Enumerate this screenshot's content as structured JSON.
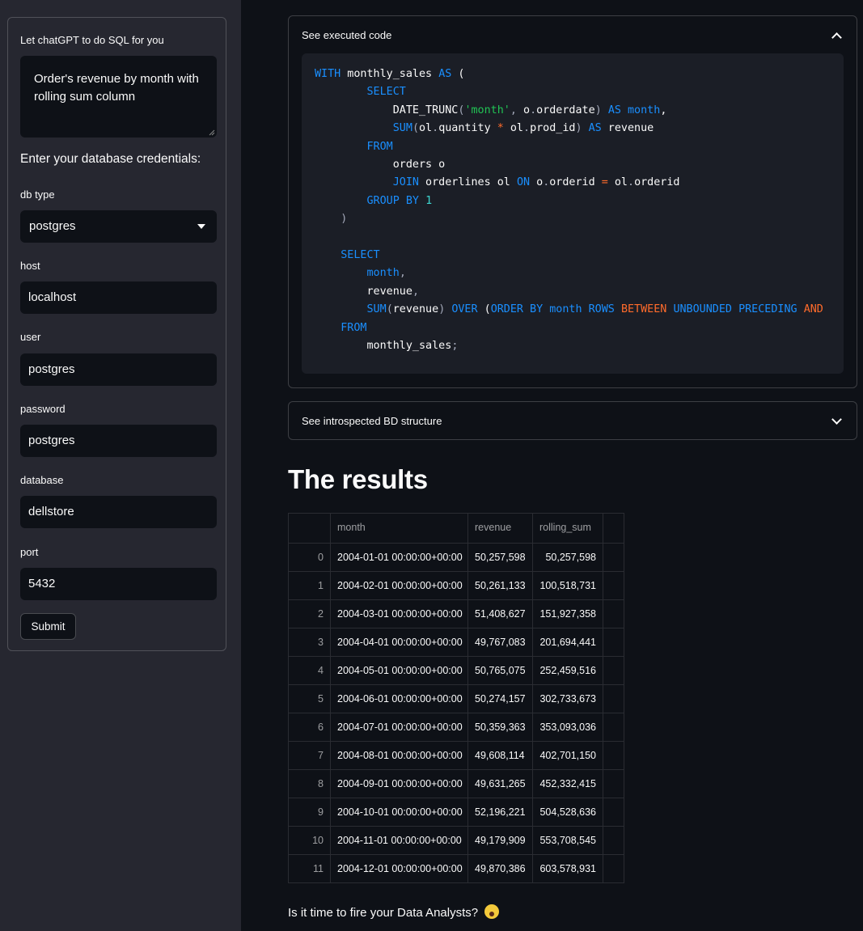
{
  "sidebar": {
    "prompt_label": "Let chatGPT to do SQL for you",
    "prompt_value": "Order's revenue by month with rolling sum column",
    "credentials_heading": "Enter your database credentials:",
    "db_type": {
      "label": "db type",
      "value": "postgres"
    },
    "host": {
      "label": "host",
      "value": "localhost"
    },
    "user": {
      "label": "user",
      "value": "postgres"
    },
    "password": {
      "label": "password",
      "value": "postgres"
    },
    "database": {
      "label": "database",
      "value": "dellstore"
    },
    "port": {
      "label": "port",
      "value": "5432"
    },
    "submit_label": "Submit"
  },
  "main": {
    "code_expander": {
      "label": "See executed code",
      "lines": [
        [
          {
            "t": "WITH",
            "c": "k"
          },
          {
            "t": " monthly_sales "
          },
          {
            "t": "AS",
            "c": "k"
          },
          {
            "t": " ("
          }
        ],
        [
          {
            "t": "        "
          },
          {
            "t": "SELECT",
            "c": "k"
          }
        ],
        [
          {
            "t": "            DATE_TRUNC"
          },
          {
            "t": "(",
            "c": "p"
          },
          {
            "t": "'month'",
            "c": "s"
          },
          {
            "t": ",",
            "c": "p"
          },
          {
            "t": " o"
          },
          {
            "t": ".",
            "c": "p"
          },
          {
            "t": "orderdate"
          },
          {
            "t": ")",
            "c": "p"
          },
          {
            "t": " "
          },
          {
            "t": "AS",
            "c": "k"
          },
          {
            "t": " "
          },
          {
            "t": "month",
            "c": "k"
          },
          {
            "t": ","
          }
        ],
        [
          {
            "t": "            "
          },
          {
            "t": "SUM",
            "c": "k"
          },
          {
            "t": "(",
            "c": "p"
          },
          {
            "t": "ol"
          },
          {
            "t": ".",
            "c": "p"
          },
          {
            "t": "quantity "
          },
          {
            "t": "*",
            "c": "o"
          },
          {
            "t": " ol"
          },
          {
            "t": ".",
            "c": "p"
          },
          {
            "t": "prod_id"
          },
          {
            "t": ")",
            "c": "p"
          },
          {
            "t": " "
          },
          {
            "t": "AS",
            "c": "k"
          },
          {
            "t": " revenue"
          }
        ],
        [
          {
            "t": "        "
          },
          {
            "t": "FROM",
            "c": "k"
          }
        ],
        [
          {
            "t": "            orders o"
          }
        ],
        [
          {
            "t": "            "
          },
          {
            "t": "JOIN",
            "c": "k"
          },
          {
            "t": " orderlines ol "
          },
          {
            "t": "ON",
            "c": "k"
          },
          {
            "t": " o"
          },
          {
            "t": ".",
            "c": "p"
          },
          {
            "t": "orderid "
          },
          {
            "t": "=",
            "c": "o"
          },
          {
            "t": " ol"
          },
          {
            "t": ".",
            "c": "p"
          },
          {
            "t": "orderid"
          }
        ],
        [
          {
            "t": "        "
          },
          {
            "t": "GROUP BY",
            "c": "k"
          },
          {
            "t": " "
          },
          {
            "t": "1",
            "c": "n"
          }
        ],
        [
          {
            "t": "    "
          },
          {
            "t": ")",
            "c": "p"
          }
        ],
        [
          {
            "t": ""
          }
        ],
        [
          {
            "t": "    "
          },
          {
            "t": "SELECT",
            "c": "k"
          }
        ],
        [
          {
            "t": "        "
          },
          {
            "t": "month",
            "c": "k"
          },
          {
            "t": ",",
            "c": "p"
          }
        ],
        [
          {
            "t": "        revenue"
          },
          {
            "t": ",",
            "c": "p"
          }
        ],
        [
          {
            "t": "        "
          },
          {
            "t": "SUM",
            "c": "k"
          },
          {
            "t": "(",
            "c": "p"
          },
          {
            "t": "revenue"
          },
          {
            "t": ")",
            "c": "p"
          },
          {
            "t": " "
          },
          {
            "t": "OVER",
            "c": "k"
          },
          {
            "t": " ("
          },
          {
            "t": "ORDER BY",
            "c": "k"
          },
          {
            "t": " "
          },
          {
            "t": "month",
            "c": "k"
          },
          {
            "t": " "
          },
          {
            "t": "ROWS",
            "c": "k"
          },
          {
            "t": " "
          },
          {
            "t": "BETWEEN",
            "c": "o"
          },
          {
            "t": " "
          },
          {
            "t": "UNBOUNDED",
            "c": "k"
          },
          {
            "t": " "
          },
          {
            "t": "PRECEDING",
            "c": "k"
          },
          {
            "t": " "
          },
          {
            "t": "AND",
            "c": "o"
          }
        ],
        [
          {
            "t": "    "
          },
          {
            "t": "FROM",
            "c": "k"
          }
        ],
        [
          {
            "t": "        monthly_sales"
          },
          {
            "t": ";",
            "c": "p"
          }
        ]
      ]
    },
    "structure_expander": {
      "label": "See introspected BD structure"
    },
    "results_title": "The results",
    "table": {
      "columns": [
        "",
        "month",
        "revenue",
        "rolling_sum"
      ],
      "rows": [
        [
          "0",
          "2004-01-01 00:00:00+00:00",
          "50,257,598",
          "50,257,598"
        ],
        [
          "1",
          "2004-02-01 00:00:00+00:00",
          "50,261,133",
          "100,518,731"
        ],
        [
          "2",
          "2004-03-01 00:00:00+00:00",
          "51,408,627",
          "151,927,358"
        ],
        [
          "3",
          "2004-04-01 00:00:00+00:00",
          "49,767,083",
          "201,694,441"
        ],
        [
          "4",
          "2004-05-01 00:00:00+00:00",
          "50,765,075",
          "252,459,516"
        ],
        [
          "5",
          "2004-06-01 00:00:00+00:00",
          "50,274,157",
          "302,733,673"
        ],
        [
          "6",
          "2004-07-01 00:00:00+00:00",
          "50,359,363",
          "353,093,036"
        ],
        [
          "7",
          "2004-08-01 00:00:00+00:00",
          "49,608,114",
          "402,701,150"
        ],
        [
          "8",
          "2004-09-01 00:00:00+00:00",
          "49,631,265",
          "452,332,415"
        ],
        [
          "9",
          "2004-10-01 00:00:00+00:00",
          "52,196,221",
          "504,528,636"
        ],
        [
          "10",
          "2004-11-01 00:00:00+00:00",
          "49,179,909",
          "553,708,545"
        ],
        [
          "11",
          "2004-12-01 00:00:00+00:00",
          "49,870,386",
          "603,578,931"
        ]
      ]
    },
    "footer_text": "Is it time to fire your Data Analysts?",
    "footer_emoji": "scream-emoji-icon"
  }
}
